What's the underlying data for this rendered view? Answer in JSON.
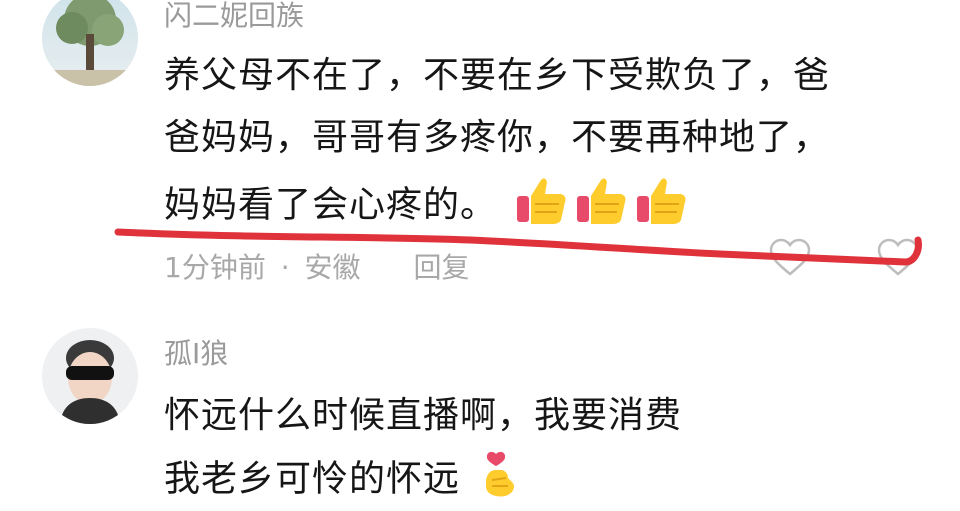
{
  "comments": [
    {
      "username": "闪二妮回族",
      "lines": [
        "养父母不在了，不要在乡下受欺负了，爸",
        "爸妈妈，哥哥有多疼你，不要再种地了，",
        "妈妈看了会心疼的。"
      ],
      "emojis": [
        "thumbs-up",
        "thumbs-up",
        "thumbs-up"
      ],
      "time": "1分钟前",
      "separator": "·",
      "location": "安徽",
      "reply_label": "回复"
    },
    {
      "username": "孤I狼",
      "lines": [
        "怀远什么时候直播啊，我要消费",
        "我老乡可怜的怀远"
      ],
      "emojis": [
        "finger-heart"
      ]
    }
  ],
  "icons": {
    "like": "heart-outline-icon",
    "dislike": "heart-outline-icon"
  },
  "colors": {
    "annotation": "#e0323a",
    "muted_text": "#a8a8a8",
    "body_text": "#161616"
  }
}
